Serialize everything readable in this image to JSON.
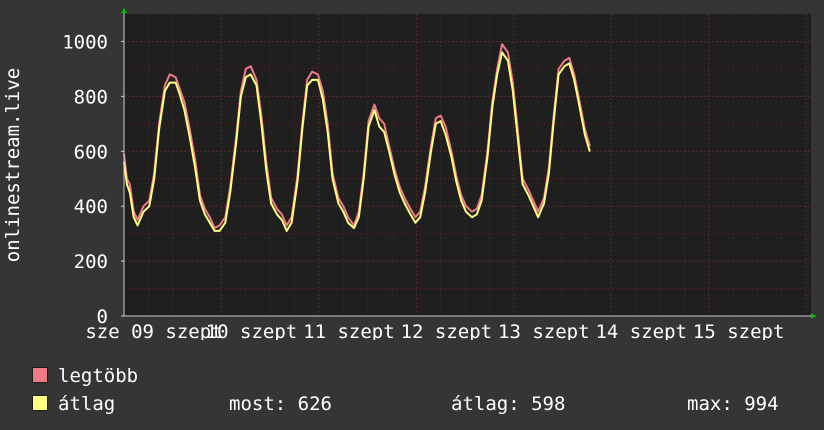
{
  "colors": {
    "background": "#353535",
    "plot_bg": "#1f1f1f",
    "grid": "#5a2a2a",
    "max_series": "#f07a85",
    "avg_series": "#ffff80",
    "arrow": "#00c000"
  },
  "legend": {
    "max_label": "legtöbb",
    "avg_label": "átlag",
    "current": "most: 626",
    "average": "átlag: 598",
    "maximum": "max: 994"
  },
  "chart_data": {
    "type": "line",
    "ylabel": "onlinestream.live",
    "ylim": [
      0,
      1100
    ],
    "yticks": [
      0,
      200,
      400,
      600,
      800,
      1000
    ],
    "x_tick_labels": [
      "sze 09 szept",
      "10 szept",
      "11 szept",
      "12 szept",
      "13 szept",
      "14 szept",
      "15 szept"
    ],
    "x_range_days": [
      0,
      7.05
    ],
    "grid": true,
    "x": [
      0.0,
      0.03,
      0.06,
      0.1,
      0.14,
      0.2,
      0.26,
      0.31,
      0.36,
      0.42,
      0.47,
      0.53,
      0.57,
      0.62,
      0.67,
      0.73,
      0.78,
      0.83,
      0.88,
      0.93,
      0.98,
      1.04,
      1.09,
      1.15,
      1.2,
      1.25,
      1.3,
      1.36,
      1.41,
      1.46,
      1.51,
      1.57,
      1.62,
      1.67,
      1.72,
      1.78,
      1.83,
      1.88,
      1.93,
      1.99,
      2.04,
      2.09,
      2.14,
      2.2,
      2.25,
      2.3,
      2.36,
      2.41,
      2.46,
      2.51,
      2.57,
      2.62,
      2.67,
      2.72,
      2.78,
      2.83,
      2.88,
      2.94,
      2.99,
      3.04,
      3.09,
      3.15,
      3.2,
      3.25,
      3.3,
      3.36,
      3.41,
      3.46,
      3.51,
      3.57,
      3.62,
      3.67,
      3.73,
      3.78,
      3.83,
      3.88,
      3.94,
      3.99,
      4.04,
      4.09,
      4.15,
      4.2,
      4.25,
      4.31,
      4.36,
      4.41,
      4.46,
      4.52,
      4.57,
      4.62,
      4.67,
      4.73,
      4.78,
      4.83,
      4.88,
      4.94,
      4.99,
      5.04,
      5.1,
      5.15,
      5.2,
      5.25,
      5.31,
      5.36,
      5.41,
      5.46,
      5.52,
      5.57,
      5.62,
      5.67,
      5.73,
      5.78,
      5.83,
      5.89,
      5.94,
      5.99,
      6.04,
      6.1,
      6.15,
      6.2,
      6.25,
      6.31,
      6.36,
      6.41,
      6.46,
      6.52,
      6.57,
      6.62,
      6.68,
      6.73,
      6.78,
      6.83,
      6.89,
      6.94,
      6.99,
      7.02
    ],
    "series": [
      {
        "name": "legtöbb",
        "values": [
          590,
          500,
          480,
          380,
          350,
          400,
          420,
          520,
          700,
          840,
          880,
          870,
          830,
          780,
          690,
          570,
          440,
          390,
          360,
          320,
          330,
          360,
          470,
          650,
          820,
          900,
          910,
          860,
          730,
          560,
          430,
          390,
          370,
          330,
          360,
          510,
          700,
          860,
          890,
          880,
          820,
          700,
          520,
          430,
          400,
          360,
          330,
          380,
          520,
          710,
          770,
          720,
          700,
          620,
          530,
          470,
          430,
          390,
          360,
          380,
          470,
          620,
          720,
          730,
          690,
          600,
          510,
          440,
          400,
          380,
          390,
          440,
          600,
          780,
          900,
          990,
          960,
          850,
          680,
          500,
          460,
          420,
          380,
          430,
          540,
          730,
          900,
          930,
          940,
          880,
          790,
          680,
          620
        ]
      },
      {
        "name": "átlag",
        "values": [
          560,
          480,
          450,
          360,
          330,
          380,
          400,
          500,
          680,
          820,
          850,
          850,
          810,
          750,
          660,
          540,
          420,
          370,
          340,
          310,
          310,
          340,
          450,
          630,
          800,
          870,
          880,
          840,
          700,
          530,
          410,
          370,
          350,
          310,
          340,
          490,
          680,
          840,
          860,
          860,
          790,
          670,
          500,
          410,
          380,
          340,
          320,
          360,
          500,
          690,
          750,
          690,
          670,
          600,
          510,
          450,
          410,
          370,
          340,
          360,
          450,
          600,
          700,
          710,
          660,
          580,
          490,
          420,
          380,
          360,
          370,
          420,
          580,
          760,
          880,
          960,
          930,
          820,
          650,
          480,
          440,
          400,
          360,
          410,
          520,
          710,
          880,
          910,
          920,
          860,
          770,
          660,
          600
        ]
      }
    ]
  }
}
